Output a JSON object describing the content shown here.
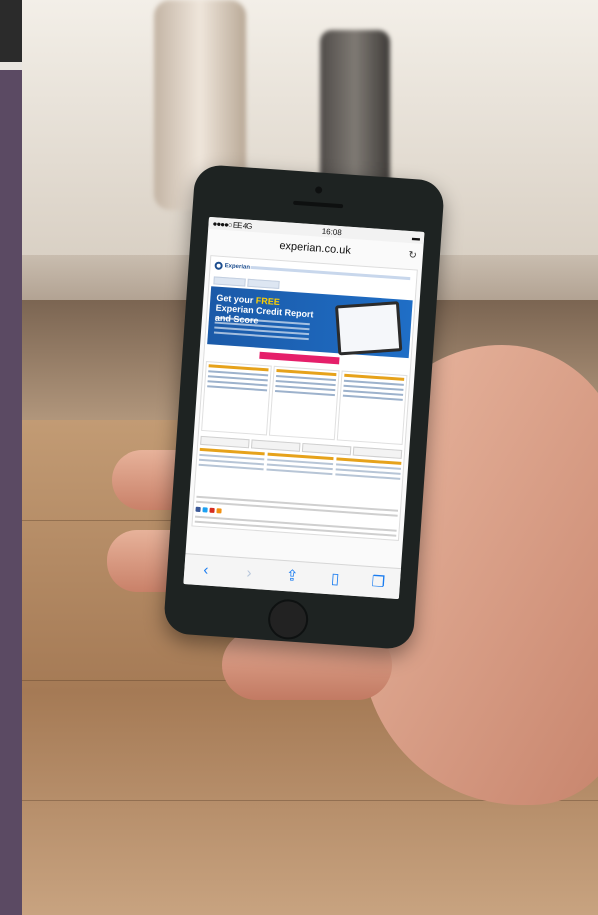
{
  "status_bar": {
    "carrier": "●●●●○ EE  4G",
    "time": "16:08"
  },
  "browser": {
    "url": "experian.co.uk"
  },
  "site": {
    "logo": "Experian",
    "hero_title_start": "Get your ",
    "hero_title_free": "FREE",
    "hero_title_end": " Experian Credit Report and Score"
  },
  "colors": {
    "brand_blue": "#1b5aa8",
    "accent_yellow": "#ffd000",
    "cta_pink": "#e51f6a",
    "safari_blue": "#1a7cf0"
  },
  "toolbar_icons": [
    "back-icon",
    "forward-icon",
    "share-icon",
    "bookmarks-icon",
    "tabs-icon"
  ]
}
